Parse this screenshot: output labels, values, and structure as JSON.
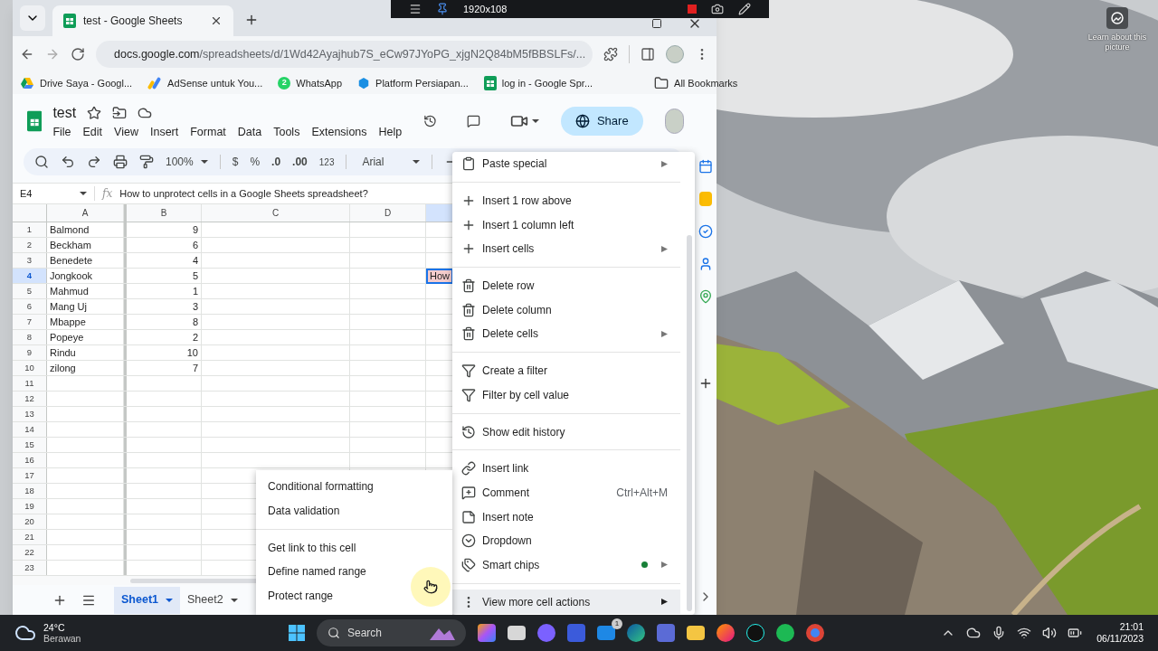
{
  "recorder": {
    "resolution": "1920x108"
  },
  "desktop": {
    "learn_about": "Learn about this picture"
  },
  "browser": {
    "tab_title": "test - Google Sheets",
    "url_host": "docs.google.com",
    "url_path": "/spreadsheets/d/1Wd42Ayajhub7S_eCw97JYoPG_xjgN2Q84bM5fBBSLFs/...",
    "bookmarks": [
      {
        "kind": "drive",
        "label": "Drive Saya - Googl..."
      },
      {
        "kind": "adsense",
        "label": "AdSense untuk You..."
      },
      {
        "kind": "whatsapp",
        "label": "WhatsApp",
        "badge": "2"
      },
      {
        "kind": "platform",
        "label": "Platform Persiapan..."
      },
      {
        "kind": "sheets",
        "label": "log in - Google Spr..."
      }
    ],
    "all_bookmarks": "All Bookmarks"
  },
  "sheets": {
    "title": "test",
    "menu": [
      "File",
      "Edit",
      "View",
      "Insert",
      "Format",
      "Data",
      "Tools",
      "Extensions",
      "Help"
    ],
    "share": "Share",
    "toolbar": {
      "zoom": "100%",
      "currency": "$",
      "percent": "%",
      "decrease_decimals": ".0",
      "increase_decimals": ".00",
      "more_formats": "123",
      "font": "Arial"
    },
    "name_box": "E4",
    "fx_label": "fx",
    "formula": "How to unprotect cells in a Google Sheets spreadsheet?",
    "columns": [
      {
        "label": "A",
        "selected": false
      },
      {
        "label": "B",
        "selected": false
      },
      {
        "label": "C",
        "selected": false
      },
      {
        "label": "D",
        "selected": false
      },
      {
        "selected": true
      }
    ],
    "rows": [
      {
        "number": "1",
        "selected": false,
        "a": "Balmond",
        "b": "9"
      },
      {
        "number": "2",
        "selected": false,
        "a": "Beckham",
        "b": "6"
      },
      {
        "number": "3",
        "selected": false,
        "a": "Benedete",
        "b": "4"
      },
      {
        "number": "4",
        "selected": true,
        "a": "Jongkook",
        "b": "5",
        "e": "How"
      },
      {
        "number": "5",
        "selected": false,
        "a": "Mahmud",
        "b": "1"
      },
      {
        "number": "6",
        "selected": false,
        "a": "Mang Uj",
        "b": "3"
      },
      {
        "number": "7",
        "selected": false,
        "a": "Mbappe",
        "b": "8"
      },
      {
        "number": "8",
        "selected": false,
        "a": "Popeye",
        "b": "2"
      },
      {
        "number": "9",
        "selected": false,
        "a": "Rindu",
        "b": "10"
      },
      {
        "number": "10",
        "selected": false,
        "a": "zilong",
        "b": "7"
      },
      {
        "number": "11",
        "selected": false
      },
      {
        "number": "12",
        "selected": false
      },
      {
        "number": "13",
        "selected": false
      },
      {
        "number": "14",
        "selected": false
      },
      {
        "number": "15",
        "selected": false
      },
      {
        "number": "16",
        "selected": false
      },
      {
        "number": "17",
        "selected": false
      },
      {
        "number": "18",
        "selected": false
      },
      {
        "number": "19",
        "selected": false
      },
      {
        "number": "20",
        "selected": false
      },
      {
        "number": "21",
        "selected": false
      },
      {
        "number": "22",
        "selected": false
      },
      {
        "number": "23",
        "selected": false
      }
    ],
    "sheet_tabs": [
      {
        "label": "Sheet1",
        "selected": true
      },
      {
        "label": "Sheet2",
        "selected": false
      }
    ]
  },
  "context_menu": {
    "groups": [
      [
        {
          "kind": "paste",
          "label": "Paste special",
          "submenu": true,
          "highlighted": false
        }
      ],
      [
        {
          "kind": "insert",
          "label": "Insert 1 row above",
          "submenu": false,
          "highlighted": false
        },
        {
          "kind": "insert",
          "label": "Insert 1 column left",
          "submenu": false,
          "highlighted": false
        },
        {
          "kind": "insert",
          "label": "Insert cells",
          "submenu": true,
          "highlighted": false
        }
      ],
      [
        {
          "kind": "delete",
          "label": "Delete row",
          "submenu": false,
          "highlighted": false
        },
        {
          "kind": "delete",
          "label": "Delete column",
          "submenu": false,
          "highlighted": false
        },
        {
          "kind": "delete",
          "label": "Delete cells",
          "submenu": true,
          "highlighted": false
        }
      ],
      [
        {
          "kind": "filter",
          "label": "Create a filter",
          "submenu": false,
          "highlighted": false
        },
        {
          "kind": "filter",
          "label": "Filter by cell value",
          "submenu": false,
          "highlighted": false
        }
      ],
      [
        {
          "kind": "history",
          "label": "Show edit history",
          "submenu": false,
          "highlighted": false
        }
      ],
      [
        {
          "kind": "link",
          "label": "Insert link",
          "submenu": false,
          "highlighted": false
        },
        {
          "kind": "comment",
          "label": "Comment",
          "shortcut": "Ctrl+Alt+M",
          "submenu": false,
          "highlighted": false
        },
        {
          "kind": "note",
          "label": "Insert note",
          "submenu": false,
          "highlighted": false
        },
        {
          "kind": "dropdown",
          "label": "Dropdown",
          "submenu": false,
          "highlighted": false
        },
        {
          "kind": "chips",
          "label": "Smart chips",
          "submenu": true,
          "new_dot": true,
          "highlighted": false
        }
      ],
      [
        {
          "kind": "more",
          "label": "View more cell actions",
          "submenu": true,
          "highlighted": true
        }
      ]
    ]
  },
  "submenu": {
    "groups": [
      [
        "Conditional formatting",
        "Data validation"
      ],
      [
        "Get link to this cell",
        "Define named range",
        "Protect range"
      ]
    ]
  },
  "taskbar": {
    "temperature": "24°C",
    "weather": "Berawan",
    "search": "Search",
    "mail_badge": "1",
    "time": "21:01",
    "date": "06/11/2023"
  }
}
